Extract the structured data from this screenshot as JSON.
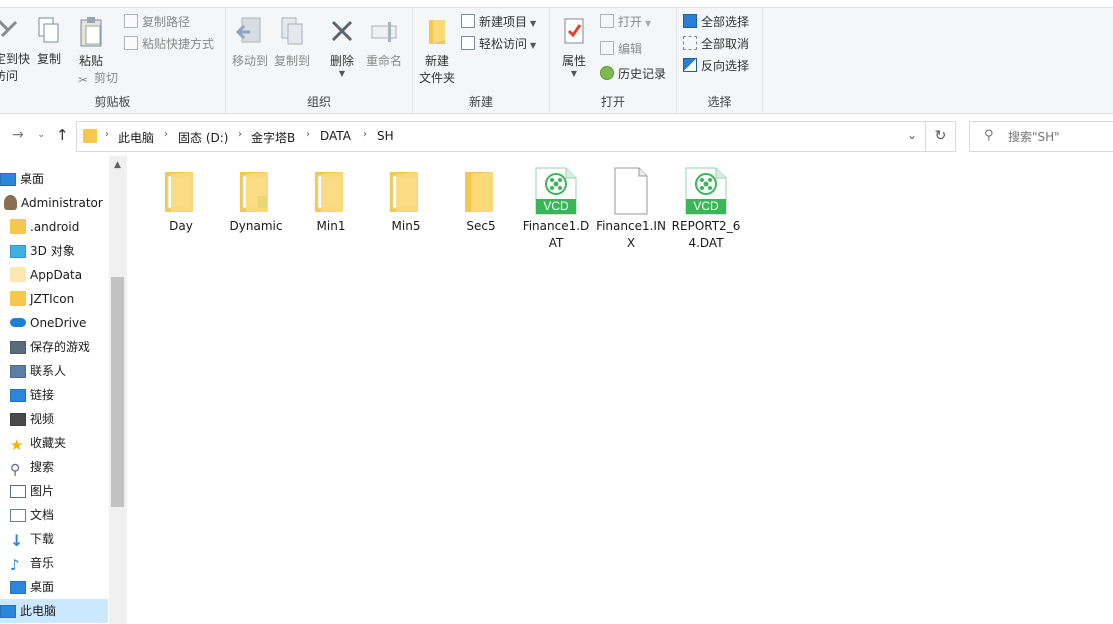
{
  "ribbon": {
    "clipboard": {
      "pin_label": "固定到快\n速访问",
      "copy_label": "复制",
      "paste_label": "粘贴",
      "copy_path_label": "复制路径",
      "paste_shortcut_label": "粘贴快捷方式",
      "cut_label": "剪切",
      "group_label": "剪贴板"
    },
    "organize": {
      "move_to_label": "移动到",
      "copy_to_label": "复制到",
      "delete_label": "删除",
      "rename_label": "重命名",
      "group_label": "组织"
    },
    "new": {
      "new_folder_label": "新建\n文件夹",
      "new_item_label": "新建项目",
      "easy_access_label": "轻松访问",
      "group_label": "新建"
    },
    "open": {
      "properties_label": "属性",
      "open_label": "打开",
      "edit_label": "编辑",
      "history_label": "历史记录",
      "group_label": "打开"
    },
    "select": {
      "select_all_label": "全部选择",
      "select_none_label": "全部取消",
      "invert_label": "反向选择",
      "group_label": "选择"
    }
  },
  "address": {
    "crumbs": [
      "此电脑",
      "固态 (D:)",
      "金字塔B",
      "DATA",
      "SH"
    ]
  },
  "search": {
    "placeholder": "搜索\"SH\""
  },
  "sidebar": {
    "items": [
      {
        "label": "桌面",
        "icon": "desktop-icon"
      },
      {
        "label": "Administrator",
        "icon": "user-icon"
      },
      {
        "label": ".android",
        "icon": "folder-icon"
      },
      {
        "label": "3D 对象",
        "icon": "3d-objects-icon"
      },
      {
        "label": "AppData",
        "icon": "folder-icon"
      },
      {
        "label": "JZTIcon",
        "icon": "folder-icon"
      },
      {
        "label": "OneDrive",
        "icon": "cloud-icon"
      },
      {
        "label": "保存的游戏",
        "icon": "saved-games-icon"
      },
      {
        "label": "联系人",
        "icon": "contacts-icon"
      },
      {
        "label": "链接",
        "icon": "links-icon"
      },
      {
        "label": "视频",
        "icon": "videos-icon"
      },
      {
        "label": "收藏夹",
        "icon": "favorites-icon"
      },
      {
        "label": "搜索",
        "icon": "search-icon"
      },
      {
        "label": "图片",
        "icon": "pictures-icon"
      },
      {
        "label": "文档",
        "icon": "documents-icon"
      },
      {
        "label": "下载",
        "icon": "downloads-icon"
      },
      {
        "label": "音乐",
        "icon": "music-icon"
      },
      {
        "label": "桌面",
        "icon": "desktop-icon"
      },
      {
        "label": "此电脑",
        "icon": "this-pc-icon"
      }
    ]
  },
  "files": [
    {
      "name": "Day",
      "type": "folder"
    },
    {
      "name": "Dynamic",
      "type": "folder"
    },
    {
      "name": "Min1",
      "type": "folder"
    },
    {
      "name": "Min5",
      "type": "folder"
    },
    {
      "name": "Sec5",
      "type": "folder"
    },
    {
      "name": "Finance1.DAT",
      "type": "vcd",
      "badge": "VCD"
    },
    {
      "name": "Finance1.INX",
      "type": "blank"
    },
    {
      "name": "REPORT2_64.DAT",
      "type": "vcd",
      "badge": "VCD"
    }
  ],
  "colors": {
    "folder": "#f5c84c",
    "vcd_green": "#3bb55a",
    "selection": "#cce8ff",
    "accent_blue": "#2a7fd4"
  }
}
